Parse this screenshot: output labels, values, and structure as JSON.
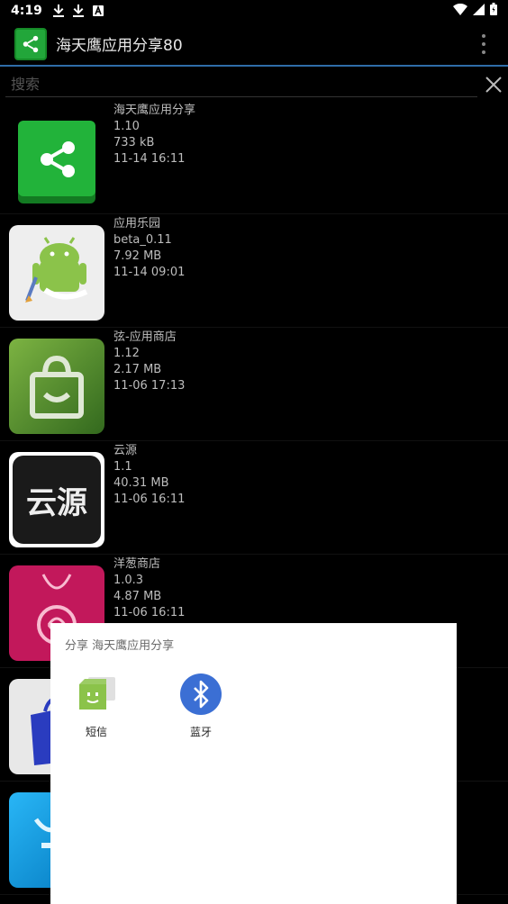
{
  "status_bar": {
    "time": "4:19"
  },
  "app_bar": {
    "title": "海天鹰应用分享80"
  },
  "search": {
    "placeholder": "搜索"
  },
  "apps": [
    {
      "name": "海天鹰应用分享",
      "version": "1.10",
      "size": "733 kB",
      "date": "11-14 16:11"
    },
    {
      "name": "应用乐园",
      "version": "beta_0.11",
      "size": "7.92 MB",
      "date": "11-14 09:01"
    },
    {
      "name": "弦-应用商店",
      "version": "1.12",
      "size": "2.17 MB",
      "date": "11-06 17:13"
    },
    {
      "name": "云源",
      "version": "1.1",
      "size": "40.31 MB",
      "date": "11-06 16:11"
    },
    {
      "name": "洋葱商店",
      "version": "1.0.3",
      "size": "4.87 MB",
      "date": "11-06 16:11"
    }
  ],
  "yunyuan_icon_text": "云源",
  "share_dialog": {
    "title": "分享 海天鹰应用分享",
    "targets": [
      {
        "label": "短信"
      },
      {
        "label": "蓝牙"
      }
    ]
  },
  "colors": {
    "accent": "#2f6da8",
    "app_green": "#22a63a",
    "bluetooth": "#3b6fd4"
  }
}
